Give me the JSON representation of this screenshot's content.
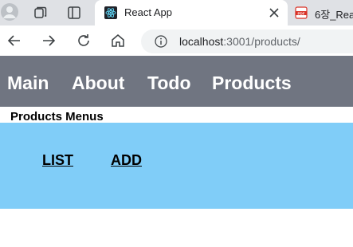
{
  "browser": {
    "tabs": [
      {
        "title": "React App",
        "active": true,
        "icon": "react-icon"
      },
      {
        "title": "6장_Reac",
        "active": false,
        "icon": "pdf-icon"
      }
    ],
    "address": {
      "host": "localhost",
      "path": ":3001/products/"
    }
  },
  "app": {
    "nav": [
      {
        "label": "Main"
      },
      {
        "label": "About"
      },
      {
        "label": "Todo"
      },
      {
        "label": "Products"
      }
    ],
    "section_title": "Products Menus",
    "menu": [
      {
        "label": "LIST"
      },
      {
        "label": "ADD"
      }
    ],
    "colors": {
      "nav_bg": "#707581",
      "menu_bg": "#80cdf8"
    }
  }
}
